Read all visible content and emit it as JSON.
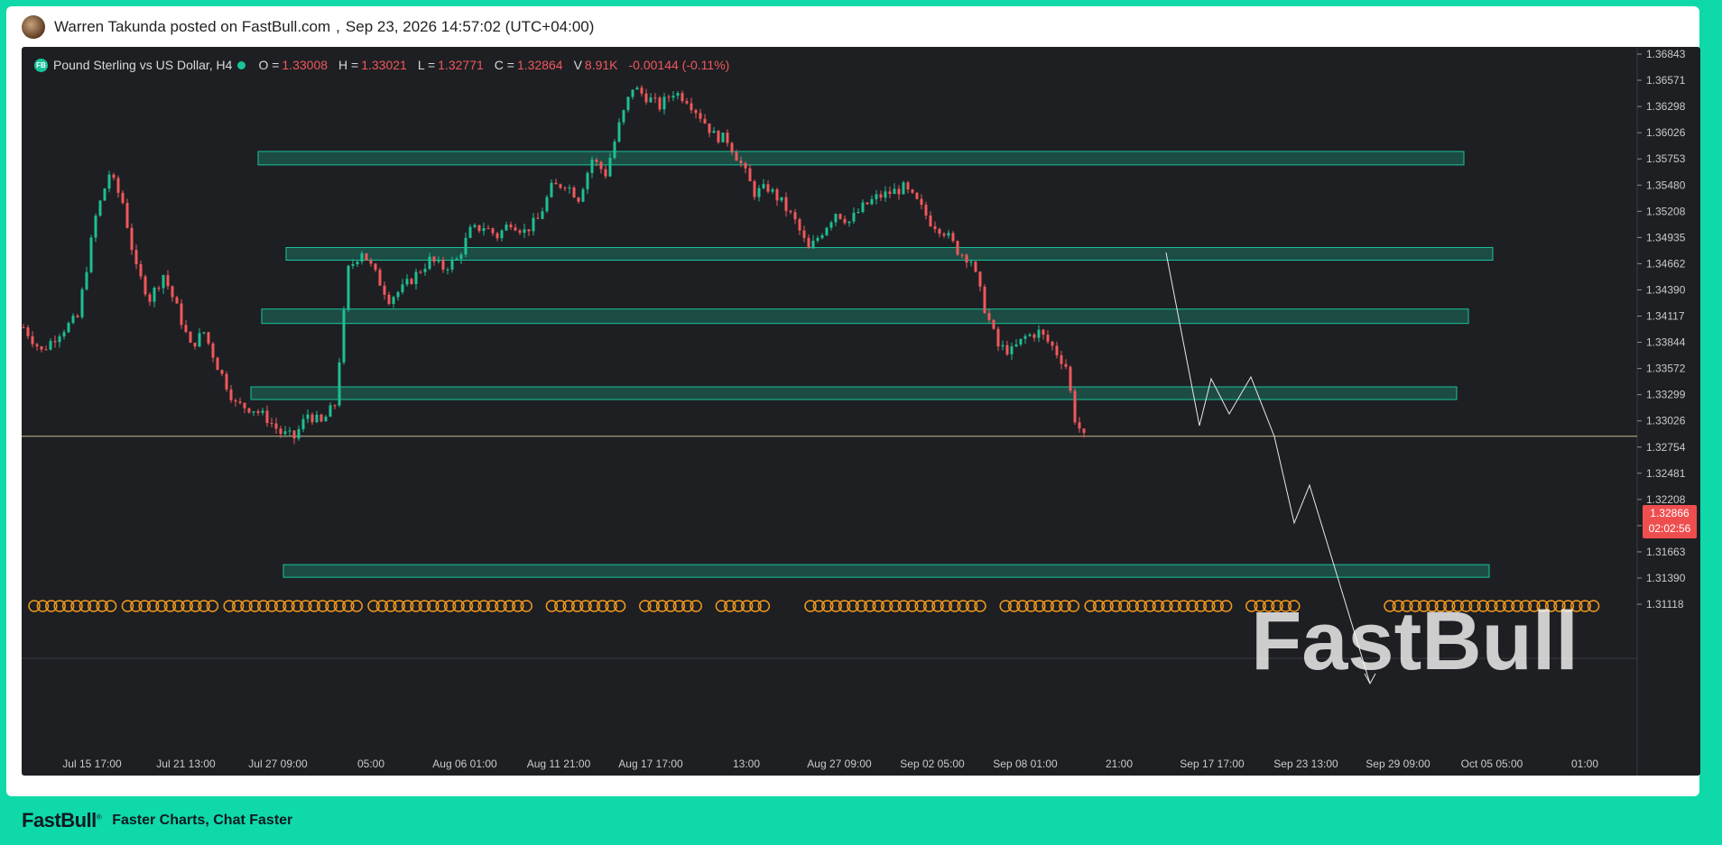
{
  "post": {
    "author": "Warren Takunda posted on FastBull.com",
    "separator": ",",
    "datetime": "Sep 23, 2026 14:57:02 (UTC+04:00)"
  },
  "legend": {
    "symbol": "Pound Sterling vs US Dollar, H4",
    "badge": "FB",
    "open_label": "O =",
    "open": "1.33008",
    "high_label": "H =",
    "high": "1.33021",
    "low_label": "L =",
    "low": "1.32771",
    "close_label": "C =",
    "close": "1.32864",
    "volume_label": "V",
    "volume": "8.91K",
    "change": "-0.00144 (-0.11%)"
  },
  "price_tag": {
    "price": "1.32866",
    "countdown": "02:02:56"
  },
  "chart_data": {
    "type": "candlestick",
    "y_ticks": [
      "1.36843",
      "1.36571",
      "1.36298",
      "1.36026",
      "1.35753",
      "1.35480",
      "1.35208",
      "1.34935",
      "1.34662",
      "1.34390",
      "1.34117",
      "1.33844",
      "1.33572",
      "1.33299",
      "1.33026",
      "1.32754",
      "1.32481",
      "1.32208",
      "1.31936",
      "1.31663",
      "1.31390",
      "1.31118"
    ],
    "ylim": [
      1.309,
      1.3705
    ],
    "x_ticks": [
      "Jul 15 17:00",
      "Jul 21 13:00",
      "Jul 27 09:00",
      "05:00",
      "Aug 06 01:00",
      "Aug 11 21:00",
      "Aug 17 17:00",
      "13:00",
      "Aug 27 09:00",
      "Sep 02 05:00",
      "Sep 08 01:00",
      "21:00",
      "Sep 17 17:00",
      "Sep 23 13:00",
      "Sep 29 09:00",
      "Oct 05 05:00",
      "01:00"
    ],
    "current_price": 1.32866,
    "zones": [
      {
        "from": 1.3569,
        "to": 1.3583
      },
      {
        "from": 1.3471,
        "to": 1.3483
      },
      {
        "from": 1.3404,
        "to": 1.3419
      },
      {
        "from": 1.3325,
        "to": 1.3338
      },
      {
        "from": 1.314,
        "to": 1.3153
      }
    ],
    "colors": {
      "up": "#1dbf93",
      "down": "#f0585b",
      "zone": "#19c39a",
      "price_line": "#c8b98a",
      "background": "#1e1f23"
    },
    "watermark": "FastBull"
  },
  "footer": {
    "logo": "FastBull",
    "logo_mark": "®",
    "tagline": "Faster Charts, Chat Faster"
  }
}
